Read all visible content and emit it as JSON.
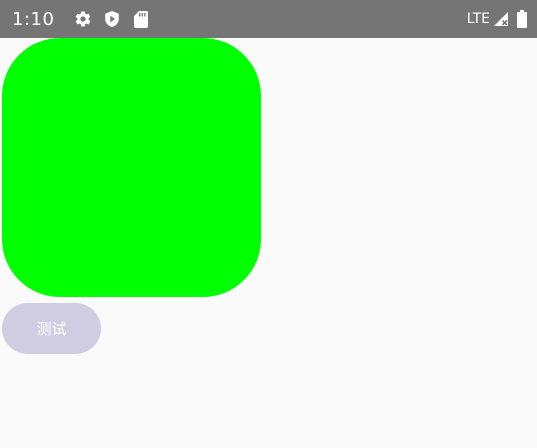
{
  "status_bar": {
    "time": "1:10",
    "network": "LTE",
    "icons": [
      "gear-icon",
      "shield-play-icon",
      "sd-card-icon",
      "signal-icon",
      "battery-icon"
    ],
    "background_color": "#757575"
  },
  "main": {
    "box_color": "#00ff00",
    "button_label": "测试",
    "button_color": "#d0cde3"
  }
}
